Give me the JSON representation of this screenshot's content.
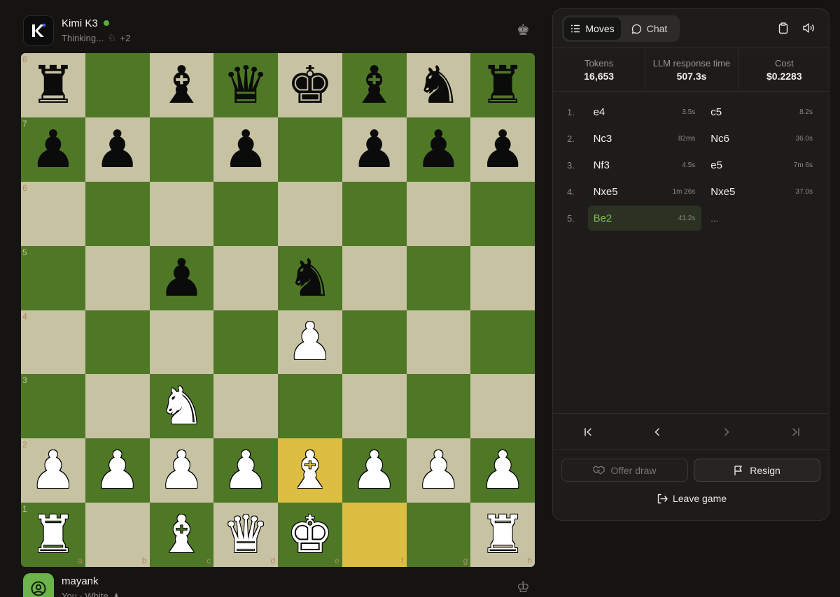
{
  "opponent": {
    "name": "Kimi K3",
    "status": "Thinking...",
    "captured_count": "+2"
  },
  "player": {
    "name": "mayank",
    "side": "You · White"
  },
  "board": {
    "ranks": [
      "8",
      "7",
      "6",
      "5",
      "4",
      "3",
      "2",
      "1"
    ],
    "files": [
      "a",
      "b",
      "c",
      "d",
      "e",
      "f",
      "g",
      "h"
    ],
    "position": [
      [
        "bR",
        "",
        "bB",
        "bQ",
        "bK",
        "bB",
        "bN",
        "bR"
      ],
      [
        "bP",
        "bP",
        "",
        "bP",
        "",
        "bP",
        "bP",
        "bP"
      ],
      [
        "",
        "",
        "",
        "",
        "",
        "",
        "",
        ""
      ],
      [
        "",
        "",
        "bP",
        "",
        "bN",
        "",
        "",
        ""
      ],
      [
        "",
        "",
        "",
        "",
        "wP",
        "",
        "",
        ""
      ],
      [
        "",
        "",
        "wN",
        "",
        "",
        "",
        "",
        ""
      ],
      [
        "wP",
        "wP",
        "wP",
        "wP",
        "wB",
        "wP",
        "wP",
        "wP"
      ],
      [
        "wR",
        "",
        "wB",
        "wQ",
        "wK",
        "",
        "",
        "wR"
      ]
    ],
    "highlight": [
      "e2",
      "f1"
    ],
    "colors": {
      "light": "#c7c2a2",
      "dark": "#4e7826",
      "highlight": "#dcbe42"
    }
  },
  "tabs": [
    {
      "label": "Moves",
      "icon": "list-icon",
      "active": true
    },
    {
      "label": "Chat",
      "icon": "chat-bubble-icon",
      "active": false
    }
  ],
  "stats": [
    {
      "label": "Tokens",
      "value": "16,653"
    },
    {
      "label": "LLM response time",
      "value": "507.3s"
    },
    {
      "label": "Cost",
      "value": "$0.2283"
    }
  ],
  "moves": [
    {
      "num": "1.",
      "white": "e4",
      "white_time": "3.5s",
      "black": "c5",
      "black_time": "8.2s"
    },
    {
      "num": "2.",
      "white": "Nc3",
      "white_time": "82ms",
      "black": "Nc6",
      "black_time": "36.0s"
    },
    {
      "num": "3.",
      "white": "Nf3",
      "white_time": "4.5s",
      "black": "e5",
      "black_time": "7m 6s"
    },
    {
      "num": "4.",
      "white": "Nxe5",
      "white_time": "1m 26s",
      "black": "Nxe5",
      "black_time": "37.0s"
    },
    {
      "num": "5.",
      "white": "Be2",
      "white_time": "41.2s",
      "black": "...",
      "black_time": ""
    }
  ],
  "current_move": "Be2",
  "actions": {
    "offer_draw": "Offer draw",
    "resign": "Resign",
    "leave": "Leave game"
  },
  "accent_color": "#7fbd52"
}
